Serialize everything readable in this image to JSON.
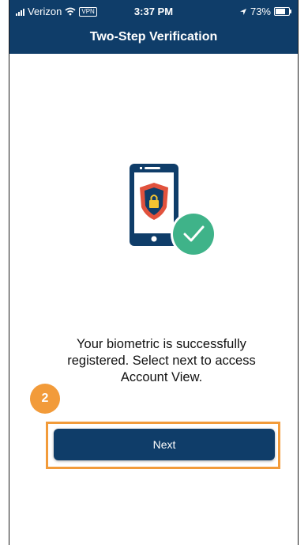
{
  "status_bar": {
    "carrier": "Verizon",
    "vpn": "VPN",
    "time": "3:37 PM",
    "battery": "73%"
  },
  "header": {
    "title": "Two-Step Verification"
  },
  "message": "Your biometric is successfully registered. Select next to access Account View.",
  "step_number": "2",
  "next_button": {
    "label": "Next"
  },
  "colors": {
    "header_bg": "#0f3d69",
    "accent_orange": "#f29b3a",
    "check_green": "#3fb389",
    "shield_red": "#e1523d"
  },
  "icons": [
    "wifi-icon",
    "location-icon",
    "battery-icon",
    "phone-icon",
    "shield-lock-icon",
    "checkmark-icon"
  ]
}
